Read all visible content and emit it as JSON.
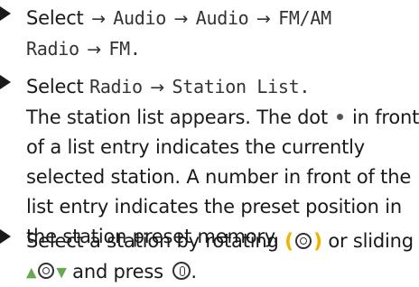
{
  "steps": [
    {
      "lines": [
        {
          "select": "Select",
          "a1": "→",
          "t1": "Audio",
          "a2": "→",
          "t2": "Audio",
          "a3": "→",
          "t3": "FM/AM"
        },
        {
          "t4": "Radio",
          "a4": "→",
          "t5": "FM."
        }
      ]
    },
    {
      "line1": {
        "select": "Select",
        "t1": "Radio",
        "a1": "→",
        "t2": "Station List."
      },
      "desc": {
        "p1": "The station list appears. The dot",
        "p2": "in front",
        "l2": "of a list entry indicates the currently",
        "l3": "selected station. A number in front of the",
        "l4": "list entry indicates the preset position in",
        "l5": "the station preset memory."
      }
    },
    {
      "l1a": "Select a station by rotating",
      "l1b": "or sliding",
      "l2b": "and press",
      "l2c": "."
    }
  ],
  "icons": {
    "bullet": "triangle-bullet-icon",
    "dot": "selected-dot-icon",
    "rotate": "controller-rotate-icon",
    "slide": "controller-slide-icon",
    "press": "controller-press-icon"
  },
  "colors": {
    "rotate_accent": "#f0b400",
    "slide_accent": "#6aa84f"
  }
}
